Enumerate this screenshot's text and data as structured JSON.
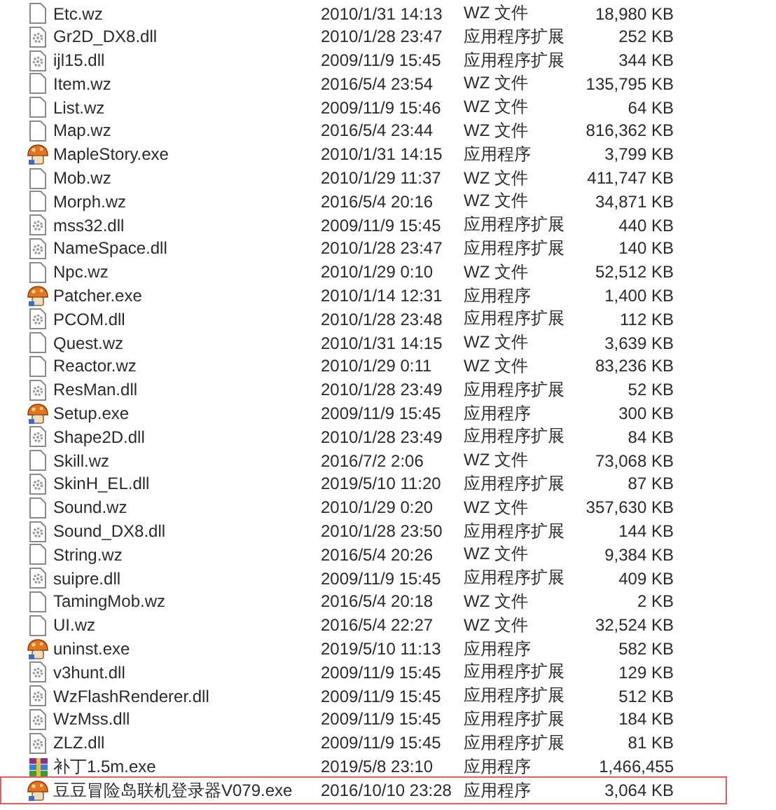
{
  "files": [
    {
      "name": "Etc.wz",
      "modified": "2010/1/31 14:13",
      "type": "WZ 文件",
      "size": "18,980 KB",
      "kind": "file",
      "highlighted": false
    },
    {
      "name": "Gr2D_DX8.dll",
      "modified": "2010/1/28 23:47",
      "type": "应用程序扩展",
      "size": "252 KB",
      "kind": "dll",
      "highlighted": false
    },
    {
      "name": "ijl15.dll",
      "modified": "2009/11/9 15:45",
      "type": "应用程序扩展",
      "size": "344 KB",
      "kind": "dll",
      "highlighted": false
    },
    {
      "name": "Item.wz",
      "modified": "2016/5/4 23:54",
      "type": "WZ 文件",
      "size": "135,795 KB",
      "kind": "file",
      "highlighted": false
    },
    {
      "name": "List.wz",
      "modified": "2009/11/9 15:46",
      "type": "WZ 文件",
      "size": "64 KB",
      "kind": "file",
      "highlighted": false
    },
    {
      "name": "Map.wz",
      "modified": "2016/5/4 23:44",
      "type": "WZ 文件",
      "size": "816,362 KB",
      "kind": "file",
      "highlighted": false
    },
    {
      "name": "MapleStory.exe",
      "modified": "2010/1/31 14:15",
      "type": "应用程序",
      "size": "3,799 KB",
      "kind": "exe",
      "highlighted": false
    },
    {
      "name": "Mob.wz",
      "modified": "2010/1/29 11:37",
      "type": "WZ 文件",
      "size": "411,747 KB",
      "kind": "file",
      "highlighted": false
    },
    {
      "name": "Morph.wz",
      "modified": "2016/5/4 20:16",
      "type": "WZ 文件",
      "size": "34,871 KB",
      "kind": "file",
      "highlighted": false
    },
    {
      "name": "mss32.dll",
      "modified": "2009/11/9 15:45",
      "type": "应用程序扩展",
      "size": "440 KB",
      "kind": "dll",
      "highlighted": false
    },
    {
      "name": "NameSpace.dll",
      "modified": "2010/1/28 23:47",
      "type": "应用程序扩展",
      "size": "140 KB",
      "kind": "dll",
      "highlighted": false
    },
    {
      "name": "Npc.wz",
      "modified": "2010/1/29 0:10",
      "type": "WZ 文件",
      "size": "52,512 KB",
      "kind": "file",
      "highlighted": false
    },
    {
      "name": "Patcher.exe",
      "modified": "2010/1/14 12:31",
      "type": "应用程序",
      "size": "1,400 KB",
      "kind": "exe",
      "highlighted": false
    },
    {
      "name": "PCOM.dll",
      "modified": "2010/1/28 23:48",
      "type": "应用程序扩展",
      "size": "112 KB",
      "kind": "dll",
      "highlighted": false
    },
    {
      "name": "Quest.wz",
      "modified": "2010/1/31 14:15",
      "type": "WZ 文件",
      "size": "3,639 KB",
      "kind": "file",
      "highlighted": false
    },
    {
      "name": "Reactor.wz",
      "modified": "2010/1/29 0:11",
      "type": "WZ 文件",
      "size": "83,236 KB",
      "kind": "file",
      "highlighted": false
    },
    {
      "name": "ResMan.dll",
      "modified": "2010/1/28 23:49",
      "type": "应用程序扩展",
      "size": "52 KB",
      "kind": "dll",
      "highlighted": false
    },
    {
      "name": "Setup.exe",
      "modified": "2009/11/9 15:45",
      "type": "应用程序",
      "size": "300 KB",
      "kind": "exe",
      "highlighted": false
    },
    {
      "name": "Shape2D.dll",
      "modified": "2010/1/28 23:49",
      "type": "应用程序扩展",
      "size": "84 KB",
      "kind": "dll",
      "highlighted": false
    },
    {
      "name": "Skill.wz",
      "modified": "2016/7/2 2:06",
      "type": "WZ 文件",
      "size": "73,068 KB",
      "kind": "file",
      "highlighted": false
    },
    {
      "name": "SkinH_EL.dll",
      "modified": "2019/5/10 11:20",
      "type": "应用程序扩展",
      "size": "87 KB",
      "kind": "dll",
      "highlighted": false
    },
    {
      "name": "Sound.wz",
      "modified": "2010/1/29 0:20",
      "type": "WZ 文件",
      "size": "357,630 KB",
      "kind": "file",
      "highlighted": false
    },
    {
      "name": "Sound_DX8.dll",
      "modified": "2010/1/28 23:50",
      "type": "应用程序扩展",
      "size": "144 KB",
      "kind": "dll",
      "highlighted": false
    },
    {
      "name": "String.wz",
      "modified": "2016/5/4 20:26",
      "type": "WZ 文件",
      "size": "9,384 KB",
      "kind": "file",
      "highlighted": false
    },
    {
      "name": "suipre.dll",
      "modified": "2009/11/9 15:45",
      "type": "应用程序扩展",
      "size": "409 KB",
      "kind": "dll",
      "highlighted": false
    },
    {
      "name": "TamingMob.wz",
      "modified": "2016/5/4 20:18",
      "type": "WZ 文件",
      "size": "2 KB",
      "kind": "file",
      "highlighted": false
    },
    {
      "name": "UI.wz",
      "modified": "2016/5/4 22:27",
      "type": "WZ 文件",
      "size": "32,524 KB",
      "kind": "file",
      "highlighted": false
    },
    {
      "name": "uninst.exe",
      "modified": "2019/5/10 11:13",
      "type": "应用程序",
      "size": "582 KB",
      "kind": "exe",
      "highlighted": false
    },
    {
      "name": "v3hunt.dll",
      "modified": "2009/11/9 15:45",
      "type": "应用程序扩展",
      "size": "129 KB",
      "kind": "dll",
      "highlighted": false
    },
    {
      "name": "WzFlashRenderer.dll",
      "modified": "2009/11/9 15:45",
      "type": "应用程序扩展",
      "size": "512 KB",
      "kind": "dll",
      "highlighted": false
    },
    {
      "name": "WzMss.dll",
      "modified": "2009/11/9 15:45",
      "type": "应用程序扩展",
      "size": "184 KB",
      "kind": "dll",
      "highlighted": false
    },
    {
      "name": "ZLZ.dll",
      "modified": "2009/11/9 15:45",
      "type": "应用程序扩展",
      "size": "81 KB",
      "kind": "dll",
      "highlighted": false
    },
    {
      "name": "补丁1.5m.exe",
      "modified": "2019/5/8 23:10",
      "type": "应用程序",
      "size": "1,466,455",
      "kind": "archive",
      "highlighted": false
    },
    {
      "name": "豆豆冒险岛联机登录器V079.exe",
      "modified": "2016/10/10 23:28",
      "type": "应用程序",
      "size": "3,064 KB",
      "kind": "exe",
      "highlighted": true
    }
  ]
}
